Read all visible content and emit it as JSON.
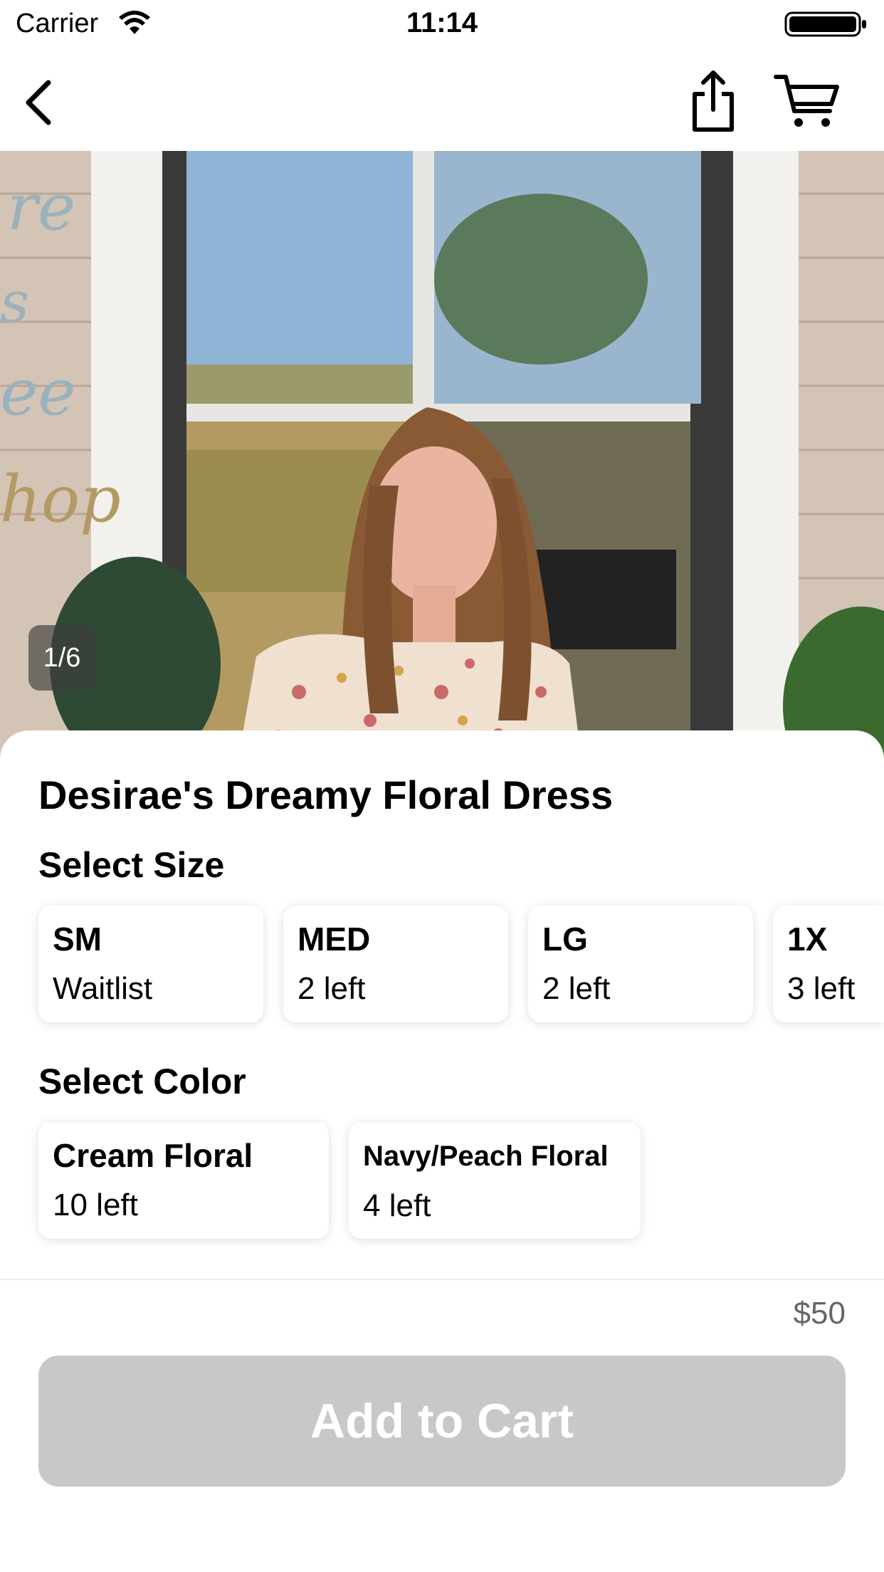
{
  "status_bar": {
    "carrier": "Carrier",
    "time": "11:14"
  },
  "nav": {
    "back_icon": "chevron-left-icon",
    "share_icon": "share-icon",
    "cart_icon": "cart-icon"
  },
  "gallery": {
    "counter": "1/6",
    "current_page": 1,
    "total_pages": 6
  },
  "product": {
    "title": "Desirae's Dreamy Floral Dress",
    "size_heading": "Select Size",
    "sizes": [
      {
        "label": "SM",
        "stock": "Waitlist"
      },
      {
        "label": "MED",
        "stock": "2 left"
      },
      {
        "label": "LG",
        "stock": "2 left"
      },
      {
        "label": "1X",
        "stock": "3 left"
      }
    ],
    "color_heading": "Select Color",
    "colors": [
      {
        "label": "Cream Floral",
        "stock": "10 left"
      },
      {
        "label": "Navy/Peach Floral",
        "stock": "4 left"
      }
    ]
  },
  "footer": {
    "price": "$50",
    "add_label": "Add to Cart",
    "button_color": "#c8c8c8"
  }
}
